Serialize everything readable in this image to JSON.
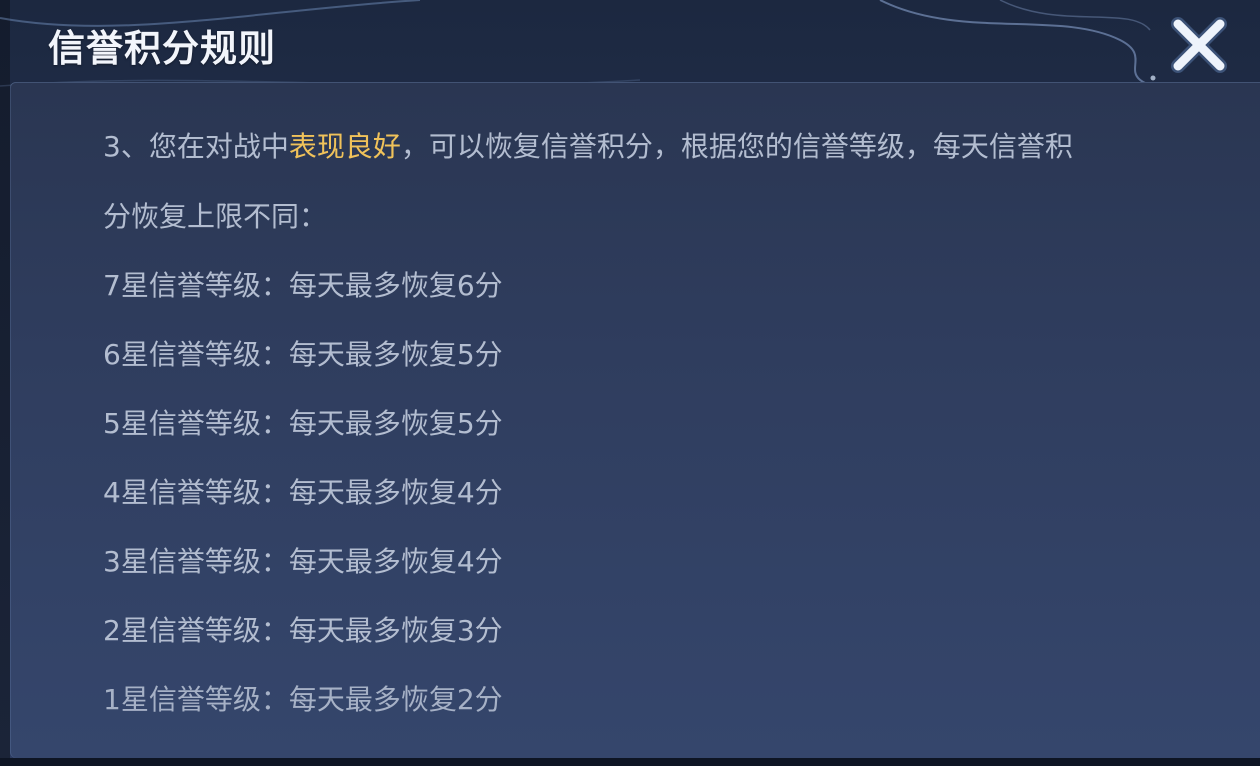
{
  "dialog": {
    "title": "信誉积分规则"
  },
  "rules": {
    "intro_prefix": "3、您在对战中",
    "intro_highlight": "表现良好",
    "intro_suffix": "，可以恢复信誉积分，根据您的信誉等级，每天信誉积",
    "intro_line2": "分恢复上限不同：",
    "levels": [
      "7星信誉等级：每天最多恢复6分",
      "6星信誉等级：每天最多恢复5分",
      "5星信誉等级：每天最多恢复5分",
      "4星信誉等级：每天最多恢复4分",
      "3星信誉等级：每天最多恢复4分",
      "2星信誉等级：每天最多恢复3分",
      "1星信誉等级：每天最多恢复2分"
    ]
  },
  "colors": {
    "highlight": "#f0c25a",
    "body_text": "#b3bdd0",
    "title_text": "#f2f5fb"
  },
  "icons": {
    "close": "close-icon"
  }
}
